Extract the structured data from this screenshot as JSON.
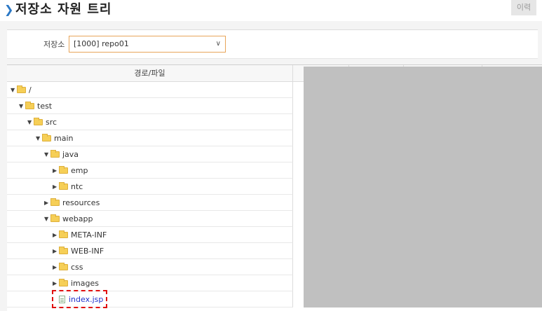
{
  "header": {
    "title": "저장소 자원 트리",
    "history_label": "이력"
  },
  "repository": {
    "label": "저장소",
    "selected": "[1000] repo01"
  },
  "table": {
    "path_header": "경로/파일"
  },
  "tree": [
    {
      "label": "/",
      "expanded": true,
      "type": "folder"
    },
    {
      "label": "test",
      "expanded": true,
      "type": "folder"
    },
    {
      "label": "src",
      "expanded": true,
      "type": "folder"
    },
    {
      "label": "main",
      "expanded": true,
      "type": "folder"
    },
    {
      "label": "java",
      "expanded": true,
      "type": "folder"
    },
    {
      "label": "emp",
      "expanded": false,
      "type": "folder"
    },
    {
      "label": "ntc",
      "expanded": false,
      "type": "folder"
    },
    {
      "label": "resources",
      "expanded": false,
      "type": "folder"
    },
    {
      "label": "webapp",
      "expanded": true,
      "type": "folder"
    },
    {
      "label": "META-INF",
      "expanded": false,
      "type": "folder"
    },
    {
      "label": "WEB-INF",
      "expanded": false,
      "type": "folder"
    },
    {
      "label": "css",
      "expanded": false,
      "type": "folder"
    },
    {
      "label": "images",
      "expanded": false,
      "type": "folder"
    },
    {
      "label": "index.jsp",
      "type": "file"
    }
  ],
  "icons": {
    "folder": "folder-icon",
    "file": "file-icon",
    "expanded": "caret-down-icon",
    "collapsed": "caret-right-icon"
  },
  "colors": {
    "accent": "#2b78c5",
    "folder": "#f6cf57",
    "file_link": "#2233cc",
    "highlight": "#e01010",
    "select_border": "#e8a55a"
  }
}
